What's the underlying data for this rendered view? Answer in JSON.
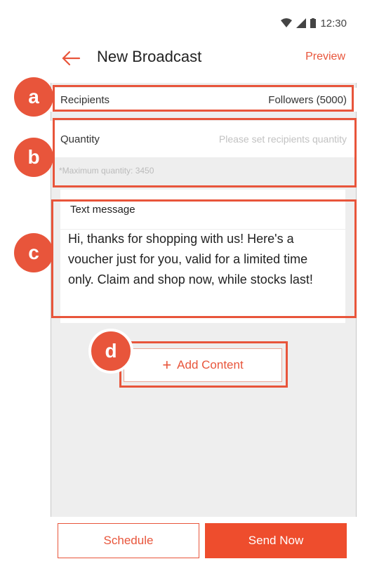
{
  "status_bar": {
    "time": "12:30"
  },
  "header": {
    "title": "New Broadcast",
    "preview_label": "Preview"
  },
  "recipients": {
    "label": "Recipients",
    "value": "Followers (5000)"
  },
  "quantity": {
    "label": "Quantity",
    "placeholder": "Please set recipients quantity",
    "note": "*Maximum quantity: 3450"
  },
  "message": {
    "label": "Text message",
    "text": "Hi, thanks for shopping with us! Here's a voucher just for you, valid for a limited time only. Claim and shop now, while stocks last!"
  },
  "add_content": {
    "icon": "+",
    "label": "Add Content"
  },
  "footer": {
    "schedule_label": "Schedule",
    "send_label": "Send Now"
  },
  "annotations": {
    "a": "a",
    "b": "b",
    "c": "c",
    "d": "d"
  },
  "colors": {
    "accent": "#ee4d2d",
    "annotation": "#e8553b"
  }
}
